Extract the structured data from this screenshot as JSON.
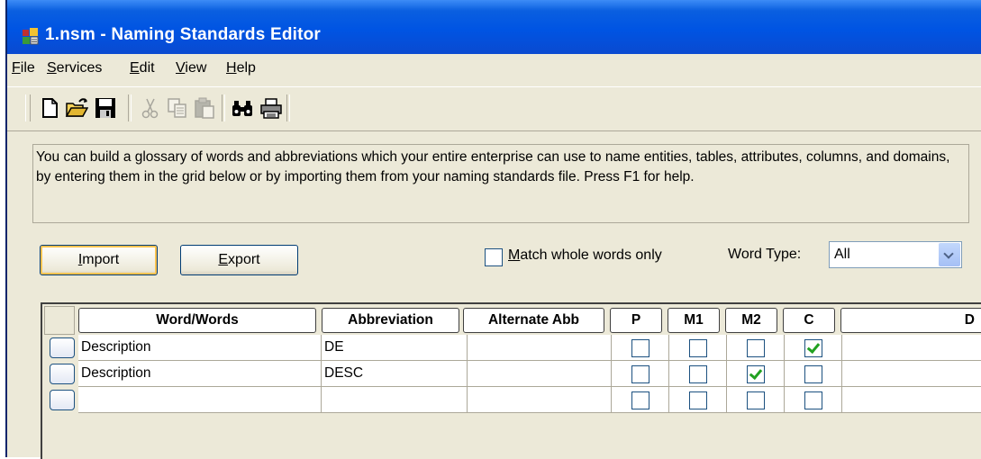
{
  "window": {
    "title": "1.nsm - Naming Standards Editor",
    "icon": "naming-standards-app-icon"
  },
  "menu": [
    {
      "accel": "F",
      "rest": "ile"
    },
    {
      "accel": "S",
      "rest": "ervices"
    },
    {
      "accel": "E",
      "rest": "dit"
    },
    {
      "accel": "V",
      "rest": "iew"
    },
    {
      "accel": "H",
      "rest": "elp"
    }
  ],
  "toolbar": {
    "icons": [
      "new-icon",
      "open-icon",
      "save-icon",
      "cut-icon",
      "copy-icon",
      "paste-icon",
      "find-icon",
      "print-icon"
    ]
  },
  "info": {
    "text": "You can build a glossary of words and abbreviations which your entire enterprise can use to name entities, tables, attributes, columns, and domains, by entering them in the grid below or by importing them from your naming standards file. Press F1 for help."
  },
  "buttons": {
    "import": {
      "accel": "I",
      "rest": "mport"
    },
    "export": {
      "accel": "E",
      "rest": "xport"
    }
  },
  "match_whole": {
    "accel": "M",
    "rest": "atch whole words only",
    "checked": false
  },
  "word_type": {
    "label": "Word Type:",
    "value": "All"
  },
  "grid": {
    "columns": [
      "Word/Words",
      "Abbreviation",
      "Alternate Abb",
      "P",
      "M1",
      "M2",
      "C",
      "D"
    ],
    "rows": [
      {
        "word": "Description",
        "abbr": "DE",
        "alt": "",
        "P": false,
        "M1": false,
        "M2": false,
        "C": true
      },
      {
        "word": "Description",
        "abbr": "DESC",
        "alt": "",
        "P": false,
        "M1": false,
        "M2": true,
        "C": false
      },
      {
        "word": "",
        "abbr": "",
        "alt": "",
        "P": false,
        "M1": false,
        "M2": false,
        "C": false
      }
    ]
  }
}
